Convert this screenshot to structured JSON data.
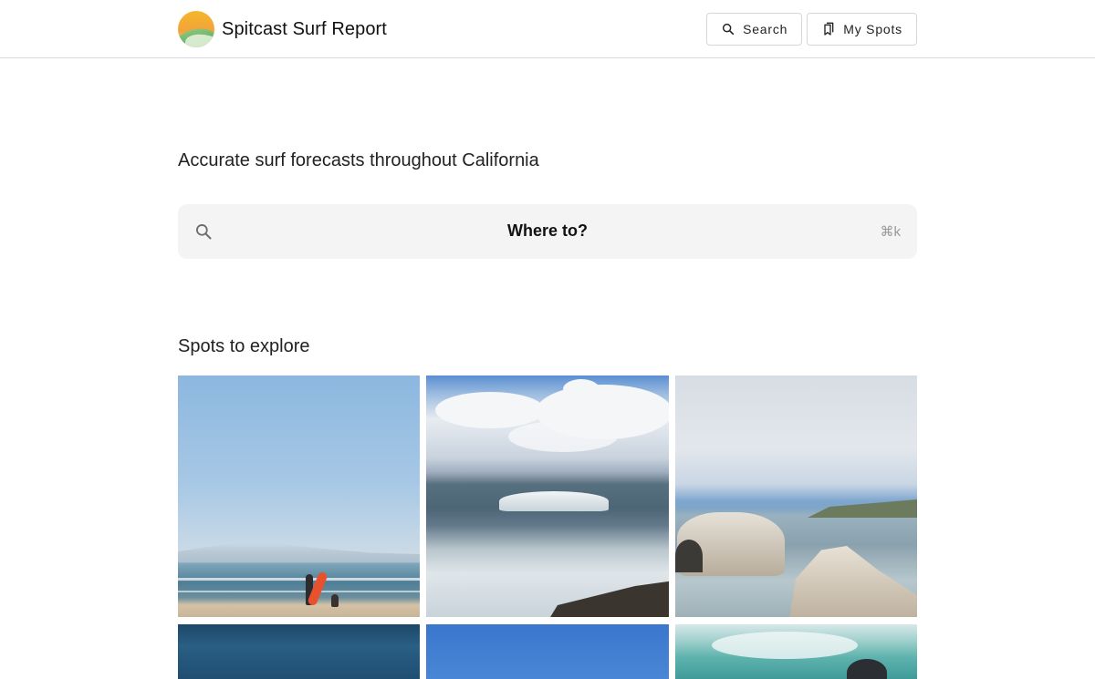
{
  "header": {
    "title": "Spitcast Surf Report",
    "nav": {
      "search_label": "Search",
      "myspots_label": "My Spots"
    }
  },
  "hero": {
    "tagline": "Accurate surf forecasts throughout California",
    "search": {
      "label": "Where to?",
      "shortcut": "⌘k"
    }
  },
  "explore": {
    "title": "Spots to explore",
    "tiles": [
      {
        "name": "beach-surfer-photo"
      },
      {
        "name": "breaking-wave-photo"
      },
      {
        "name": "rock-arch-birds-photo"
      },
      {
        "name": "ocean-swell-photo"
      },
      {
        "name": "blue-sky-photo"
      },
      {
        "name": "wave-spray-photo"
      }
    ]
  },
  "colors": {
    "search_bg": "#f4f4f4",
    "border": "#d9d9d9",
    "logo_orange": "#f5b62b",
    "logo_green": "#3f9e57"
  },
  "icons": {
    "logo": "sunset-wave-logo",
    "search": "search-icon",
    "bookmark": "bookmark-icon"
  }
}
